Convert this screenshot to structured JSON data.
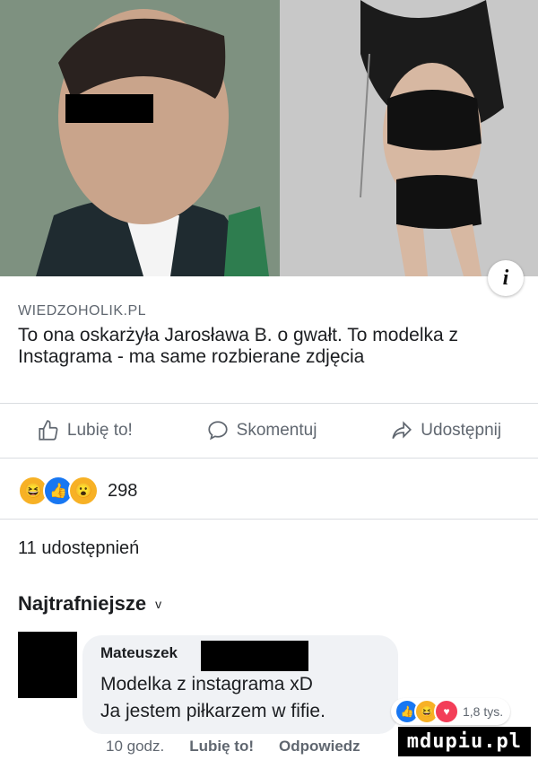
{
  "post": {
    "domain": "WIEDZOHOLIK.PL",
    "headline": "To ona oskarżyła Jarosława B. o gwałt. To modelka z Instagrama - ma same rozbierane zdjęcia",
    "info_label": "i"
  },
  "actions": {
    "like_label": "Lubię to!",
    "comment_label": "Skomentuj",
    "share_label": "Udostępnij"
  },
  "reactions": {
    "count": "298",
    "types": [
      "haha",
      "like",
      "wow"
    ]
  },
  "shares_text": "11 udostępnień",
  "comments_sort": {
    "label": "Najtrafniejsze",
    "chevron": "v"
  },
  "comment": {
    "author": "Mateuszek",
    "line1": "Modelka z instagrama xD",
    "line2": "Ja jestem piłkarzem w fifie.",
    "reaction_count": "1,8 tys.",
    "time": "10 godz.",
    "like_link": "Lubię to!",
    "reply_link": "Odpowiedz"
  },
  "watermark": "mdupiu.pl",
  "colors": {
    "like_blue": "#1877f2",
    "haha_yellow": "#f7b125",
    "love_red": "#f33e58",
    "text_secondary": "#606770"
  }
}
